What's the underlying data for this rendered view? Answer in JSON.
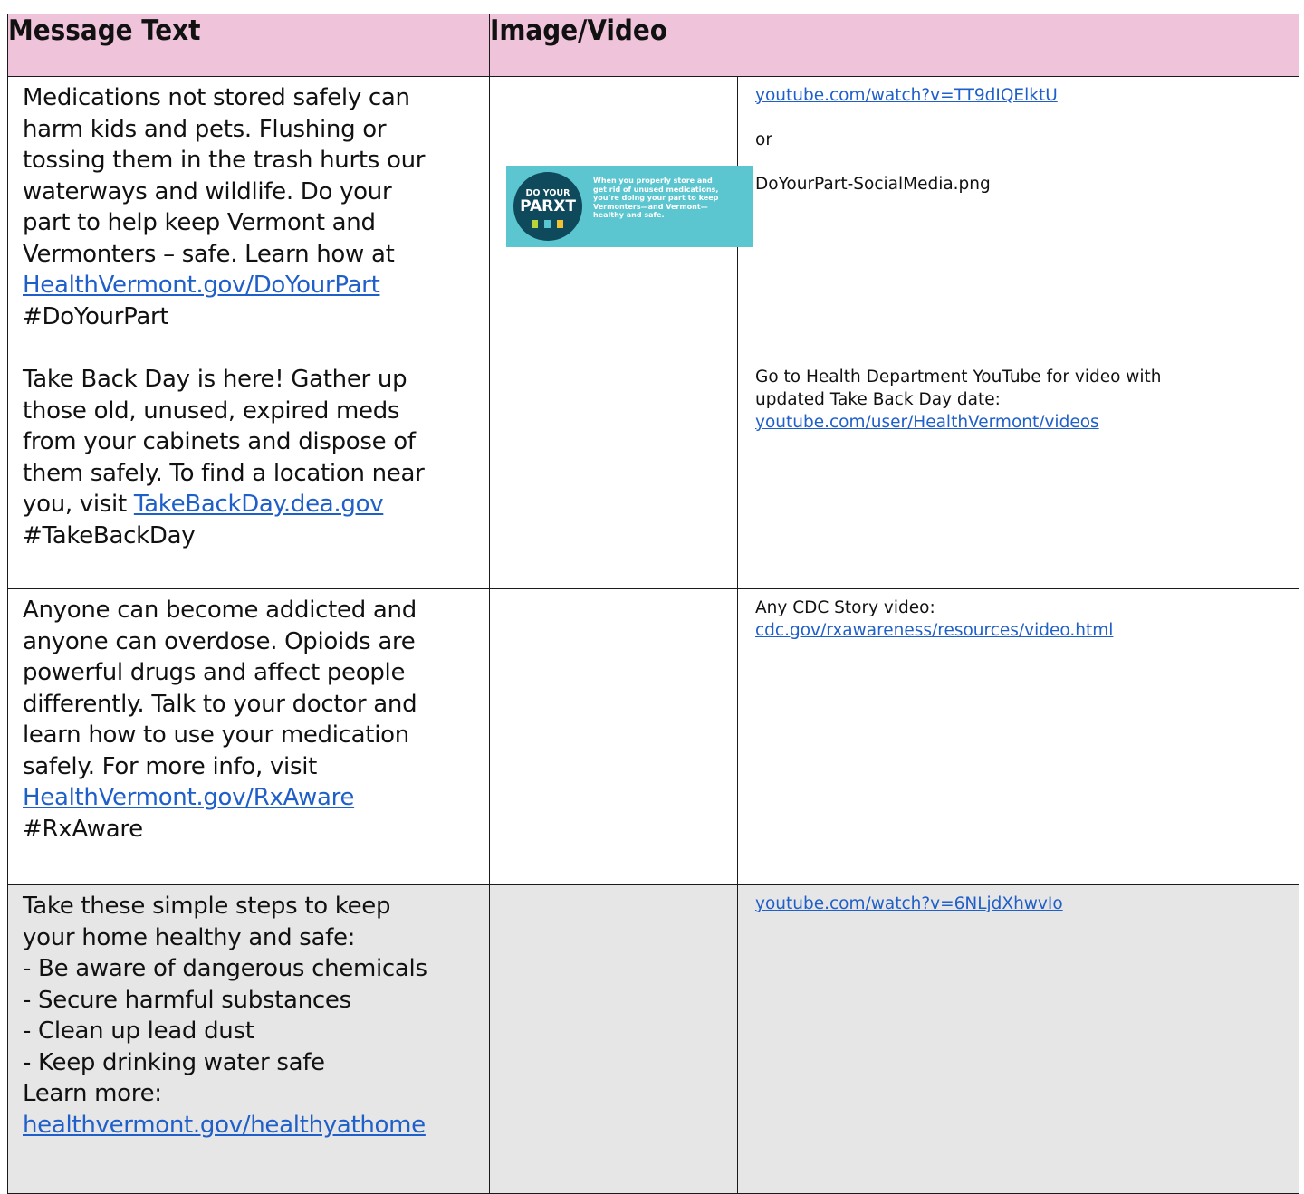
{
  "header": {
    "message_text": "Message Text",
    "image_video": "Image/Video"
  },
  "rows": [
    {
      "message_lines": [
        "Medications not stored safely can",
        "harm kids and pets. Flushing or",
        "tossing them in the trash hurts our",
        "waterways and wildlife. Do your",
        "part to help keep Vermont and",
        "Vermonters – safe. Learn how at"
      ],
      "message_link": "HealthVermont.gov/DoYourPart",
      "message_tail": "#DoYourPart",
      "image": {
        "badge_line1": "DO YOUR",
        "badge_line2": "PARXT",
        "blurb_lines": [
          "When you properly store and",
          "get rid of unused medications,",
          "you’re doing your part to keep",
          "Vermonters—and Vermont—",
          "healthy and safe."
        ]
      },
      "media_link": "youtube.com/watch?v=TT9dIQElktU",
      "media_or": "or",
      "media_file": "DoYourPart-SocialMedia.png"
    },
    {
      "message_lines": [
        "Take Back Day is here! Gather up",
        "those old, unused, expired meds",
        "from your cabinets and dispose of",
        "them safely. To find a location near"
      ],
      "message_prefix": "you, visit ",
      "message_link": "TakeBackDay.dea.gov",
      "message_tail": "#TakeBackDay",
      "media_lines": [
        "Go to Health Department YouTube for video with",
        "updated Take Back Day date:"
      ],
      "media_link": "youtube.com/user/HealthVermont/videos"
    },
    {
      "message_lines": [
        "Anyone can become addicted and",
        "anyone can overdose. Opioids are",
        "powerful drugs and affect people",
        "differently. Talk to your doctor and",
        "learn how to use your medication",
        "safely. For more info, visit"
      ],
      "message_link": "HealthVermont.gov/RxAware",
      "message_tail": "#RxAware",
      "media_lines": [
        "Any CDC Story video:"
      ],
      "media_link": "cdc.gov/rxawareness/resources/video.html"
    },
    {
      "message_lines": [
        "Take these simple steps to keep",
        "your home healthy and safe:",
        "- Be aware of dangerous chemicals",
        "- Secure harmful substances",
        "- Clean up lead dust",
        "- Keep drinking water safe",
        "Learn more:"
      ],
      "message_link": "healthvermont.gov/healthyathome",
      "media_link": "youtube.com/watch?v=6NLjdXhwvIo"
    }
  ]
}
